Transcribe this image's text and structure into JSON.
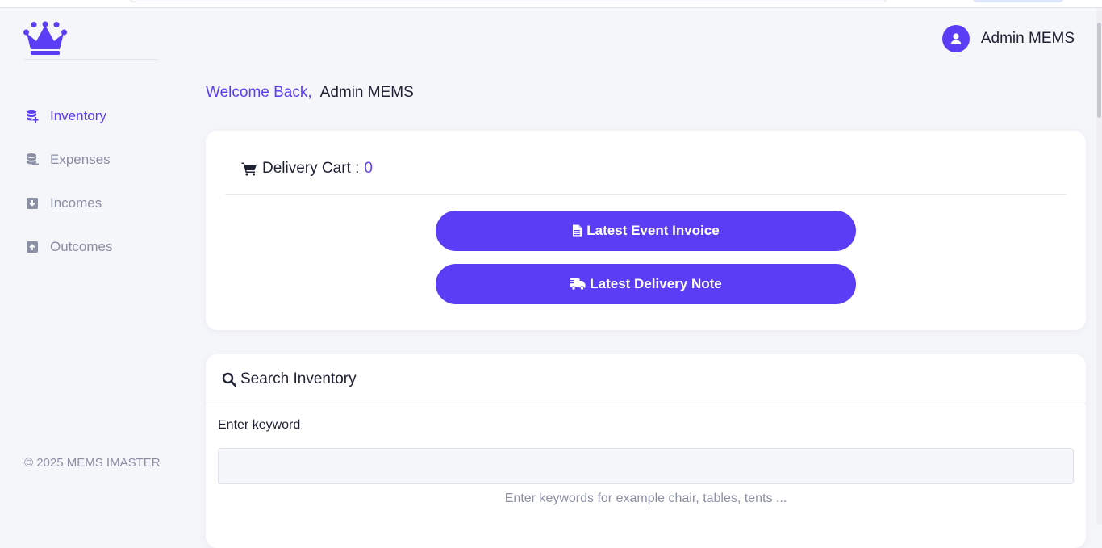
{
  "sidebar": {
    "logo": "crown-icon",
    "items": [
      {
        "label": "Inventory",
        "icon": "database-plus-icon",
        "active": true
      },
      {
        "label": "Expenses",
        "icon": "coins-icon",
        "active": false
      },
      {
        "label": "Incomes",
        "icon": "square-arrow-down-icon",
        "active": false
      },
      {
        "label": "Outcomes",
        "icon": "square-arrow-up-icon",
        "active": false
      }
    ],
    "copyright": "© 2025 MEMS IMASTER"
  },
  "header": {
    "user_name": "Admin MEMS",
    "avatar_icon": "user-circle-icon"
  },
  "welcome": {
    "greeting": "Welcome Back,",
    "name": "Admin MEMS"
  },
  "cart": {
    "label": "Delivery Cart :",
    "count": "0",
    "icon": "cart-icon",
    "buttons": {
      "invoice": "Latest Event Invoice",
      "delivery": "Latest Delivery Note"
    }
  },
  "search": {
    "title": "Search Inventory",
    "icon": "search-icon",
    "keyword_label": "Enter keyword",
    "keyword_value": "",
    "help_text": "Enter keywords for example chair, tables, tents ..."
  },
  "colors": {
    "accent": "#5b3df5",
    "muted": "#8a8fa3",
    "background": "#f5f6fa"
  }
}
